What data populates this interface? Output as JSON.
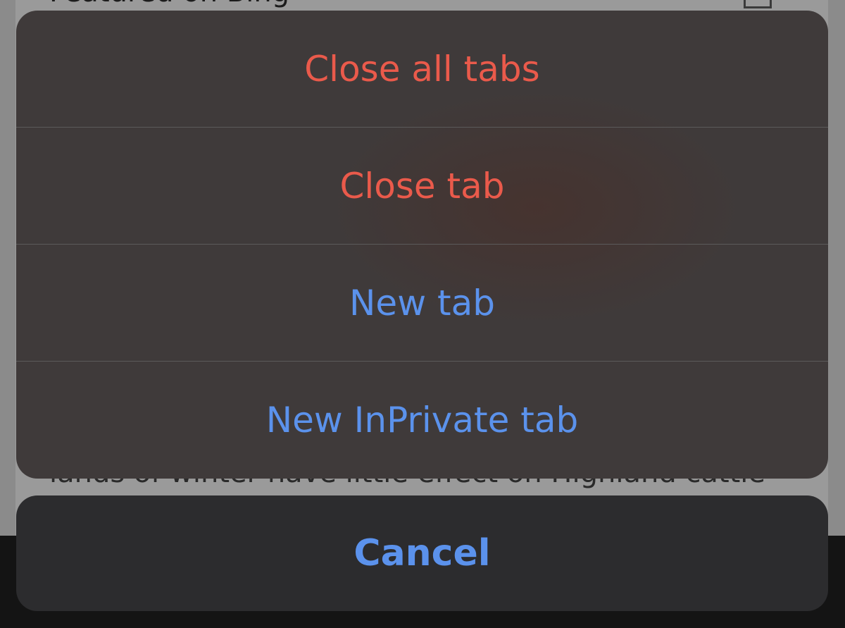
{
  "background": {
    "heading": "Featured on Bing",
    "body_text": "lands of winter have little effect on Highland cattle"
  },
  "action_sheet": {
    "items": [
      {
        "label": "Close all tabs",
        "style": "destructive"
      },
      {
        "label": "Close tab",
        "style": "destructive"
      },
      {
        "label": "New tab",
        "style": "normal"
      },
      {
        "label": "New InPrivate tab",
        "style": "normal"
      }
    ],
    "cancel_label": "Cancel"
  },
  "colors": {
    "destructive": "#ea5a4b",
    "accent": "#5b92ec",
    "sheet_background": "#414040",
    "cancel_background": "#2c2c2e"
  }
}
